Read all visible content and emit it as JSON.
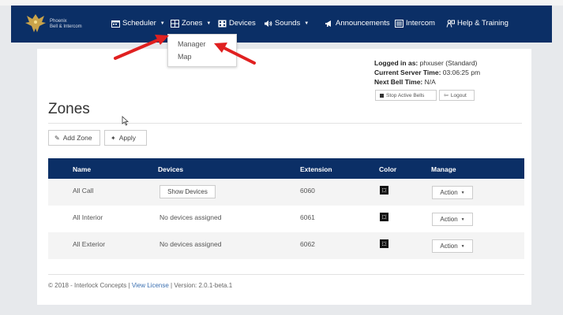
{
  "brand": {
    "line1": "Phoenix",
    "line2": "Bell & Intercom"
  },
  "nav": {
    "scheduler": "Scheduler",
    "zones": "Zones",
    "devices": "Devices",
    "sounds": "Sounds",
    "announcements": "Announcements",
    "intercom": "Intercom",
    "help": "Help & Training"
  },
  "zones_menu": {
    "manager": "Manager",
    "map": "Map"
  },
  "session": {
    "logged_in_label": "Logged in as:",
    "logged_in_value": "phxuser (Standard)",
    "server_time_label": "Current Server Time:",
    "server_time_value": "03:06:25 pm",
    "next_bell_label": "Next Bell Time:",
    "next_bell_value": "N/A",
    "stop_bells": "Stop Active Bells",
    "logout": "Logout"
  },
  "page_title": "Zones",
  "toolbar": {
    "add_zone": "Add Zone",
    "apply": "Apply"
  },
  "table": {
    "headers": {
      "name": "Name",
      "devices": "Devices",
      "extension": "Extension",
      "color": "Color",
      "manage": "Manage"
    },
    "rows": [
      {
        "name": "All Call",
        "devices": "Show Devices",
        "extension": "6060",
        "action": "Action",
        "color": "#111111"
      },
      {
        "name": "All Interior",
        "devices": "No devices assigned",
        "extension": "6061",
        "action": "Action",
        "color": "#111111"
      },
      {
        "name": "All Exterior",
        "devices": "No devices assigned",
        "extension": "6062",
        "action": "Action",
        "color": "#111111"
      }
    ]
  },
  "footer": {
    "copyright": "© 2018 - Interlock Concepts |",
    "license": "View License",
    "version": "| Version: 2.0.1-beta.1"
  },
  "colors": {
    "navbar": "#0b2f66",
    "arrow": "#e02020",
    "link": "#3a6fb0"
  }
}
